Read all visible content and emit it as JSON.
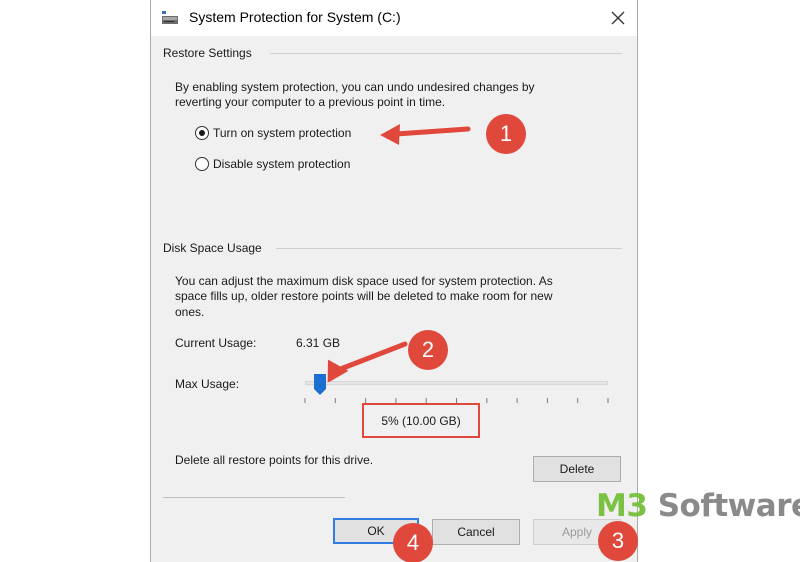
{
  "window": {
    "title": "System Protection for System (C:)"
  },
  "restore_settings": {
    "group_label": "Restore Settings",
    "description_line1": "By enabling system protection, you can undo undesired changes by",
    "description_line2": "reverting your computer to a previous point in time.",
    "options": [
      {
        "label": "Turn on system protection",
        "selected": true
      },
      {
        "label": "Disable system protection",
        "selected": false
      }
    ]
  },
  "disk_space": {
    "group_label": "Disk Space Usage",
    "description_line1": "You can adjust the maximum disk space used for system protection. As",
    "description_line2": "space fills up, older restore points will be deleted to make room for new",
    "description_line3": "ones.",
    "current_usage_label": "Current Usage:",
    "current_usage_value": "6.31 GB",
    "max_usage_label": "Max Usage:",
    "max_usage_percent": 5,
    "max_usage_display": "5% (10.00 GB)",
    "delete_text": "Delete all restore points for this drive.",
    "delete_button": "Delete"
  },
  "buttons": {
    "ok": "OK",
    "cancel": "Cancel",
    "apply": "Apply"
  },
  "annotations": {
    "badge_1": "1",
    "badge_2": "2",
    "badge_3": "3",
    "badge_4": "4",
    "accent_color": "#e0483c"
  },
  "watermark": {
    "part1": "M3",
    "part2": " Software"
  },
  "colors": {
    "dialog_bg": "#f0f0f0",
    "primary_border": "#2f7de1",
    "thumb": "#1a6fd1"
  }
}
